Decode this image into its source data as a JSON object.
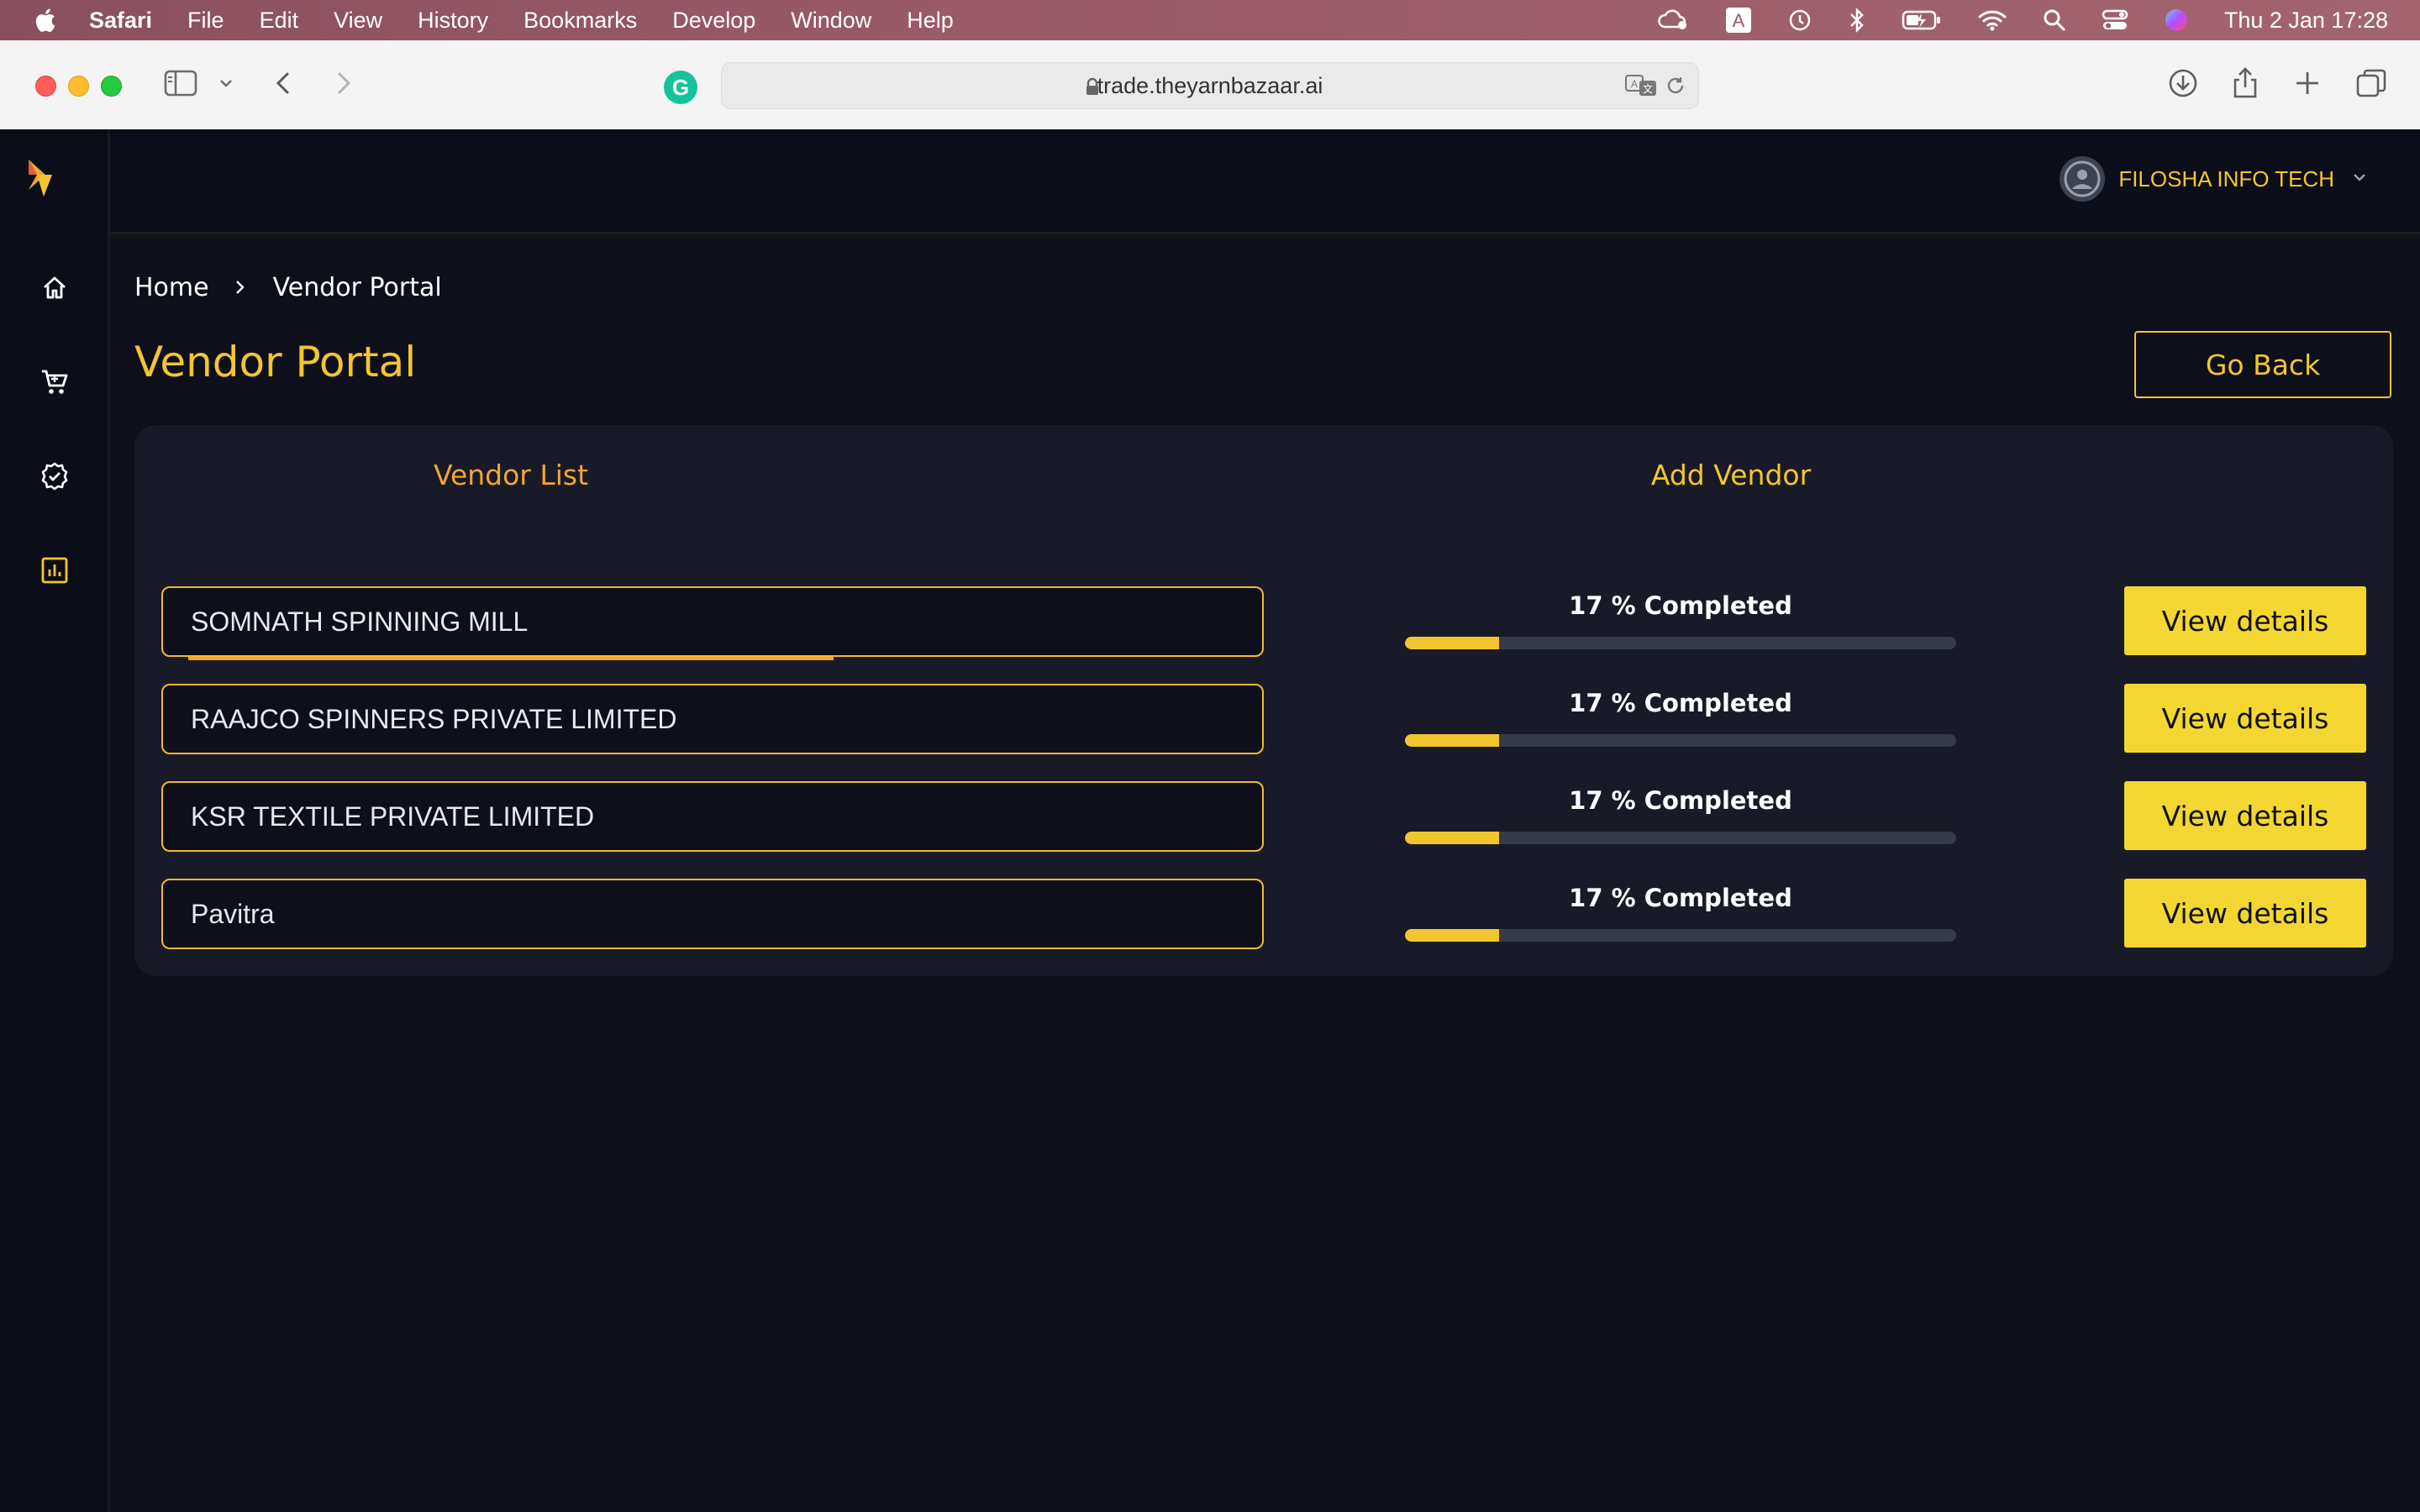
{
  "menubar": {
    "app_name": "Safari",
    "items": [
      "File",
      "Edit",
      "View",
      "History",
      "Bookmarks",
      "Develop",
      "Window",
      "Help"
    ],
    "clock": "Thu 2 Jan  17:28"
  },
  "browser": {
    "url": "trade.theyarnbazaar.ai",
    "extension_letter": "G"
  },
  "header": {
    "user_name": "FILOSHA INFO TECH"
  },
  "breadcrumb": {
    "home": "Home",
    "current": "Vendor Portal"
  },
  "page": {
    "title": "Vendor Portal",
    "go_back_label": "Go Back"
  },
  "tabs": {
    "vendor_list": "Vendor List",
    "add_vendor": "Add Vendor",
    "active": "Vendor List"
  },
  "vendors": [
    {
      "name": "SOMNATH SPINNING MILL",
      "progress_label": "17 % Completed",
      "progress": 17,
      "button": "View details"
    },
    {
      "name": "RAAJCO SPINNERS PRIVATE LIMITED",
      "progress_label": "17 % Completed",
      "progress": 17,
      "button": "View details"
    },
    {
      "name": "KSR TEXTILE PRIVATE LIMITED",
      "progress_label": "17 % Completed",
      "progress": 17,
      "button": "View details"
    },
    {
      "name": "Pavitra",
      "progress_label": "17 % Completed",
      "progress": 17,
      "button": "View details"
    }
  ],
  "colors": {
    "accent": "#f4c530",
    "tab_active": "#f2a437",
    "button_bg": "#f4d633",
    "background": "#0d101b",
    "card": "#181b27"
  },
  "icons": {
    "sidebar": [
      "home-icon",
      "cart-icon",
      "verified-badge-icon",
      "analytics-chart-icon"
    ]
  }
}
